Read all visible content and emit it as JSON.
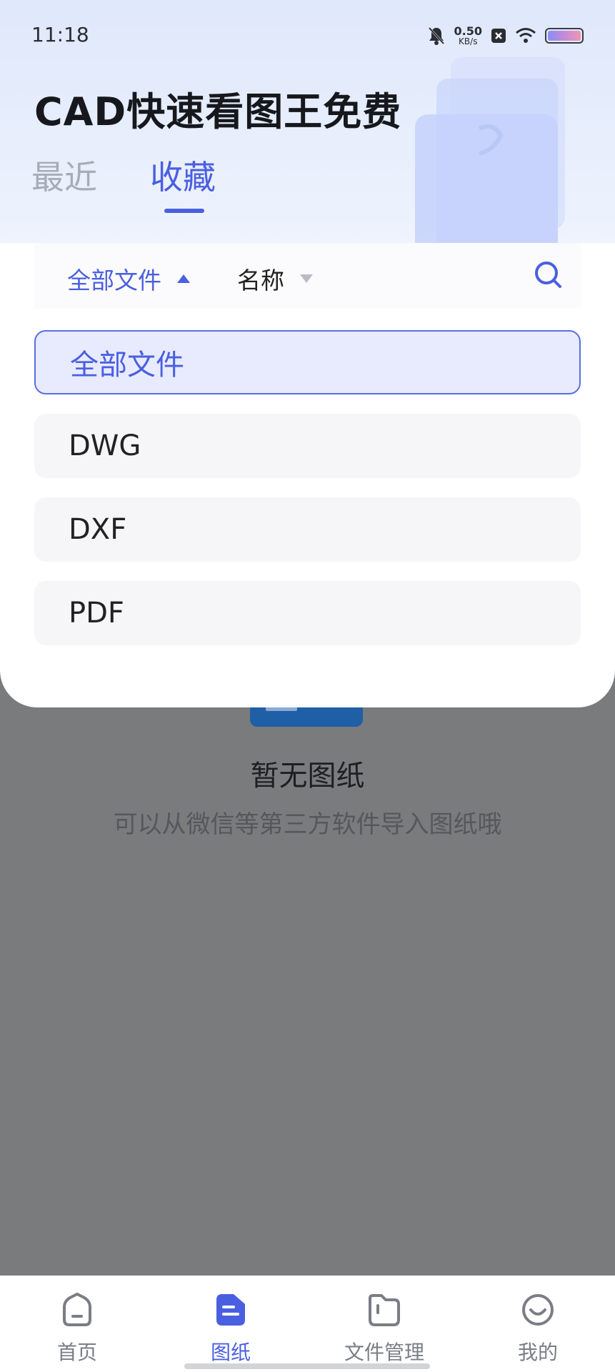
{
  "status_bar": {
    "time": "11:18",
    "net_speed_value": "0.50",
    "net_speed_unit": "KB/s"
  },
  "app_title": "CAD快速看图王免费",
  "tabs": [
    {
      "label": "最近",
      "active": false
    },
    {
      "label": "收藏",
      "active": true
    }
  ],
  "filter_bar": {
    "type_label": "全部文件",
    "sort_label": "名称"
  },
  "file_type_options": [
    {
      "label": "全部文件",
      "selected": true
    },
    {
      "label": "DWG",
      "selected": false
    },
    {
      "label": "DXF",
      "selected": false
    },
    {
      "label": "PDF",
      "selected": false
    }
  ],
  "empty_state": {
    "title": "暂无图纸",
    "subtitle": "可以从微信等第三方软件导入图纸哦"
  },
  "bottom_nav": [
    {
      "label": "首页",
      "icon": "home-icon",
      "active": false
    },
    {
      "label": "图纸",
      "icon": "drawings-icon",
      "active": true
    },
    {
      "label": "文件管理",
      "icon": "folder-icon",
      "active": false
    },
    {
      "label": "我的",
      "icon": "profile-icon",
      "active": false
    }
  ],
  "colors": {
    "accent": "#4a5fe0",
    "dim_overlay": "#7a7b7d"
  }
}
